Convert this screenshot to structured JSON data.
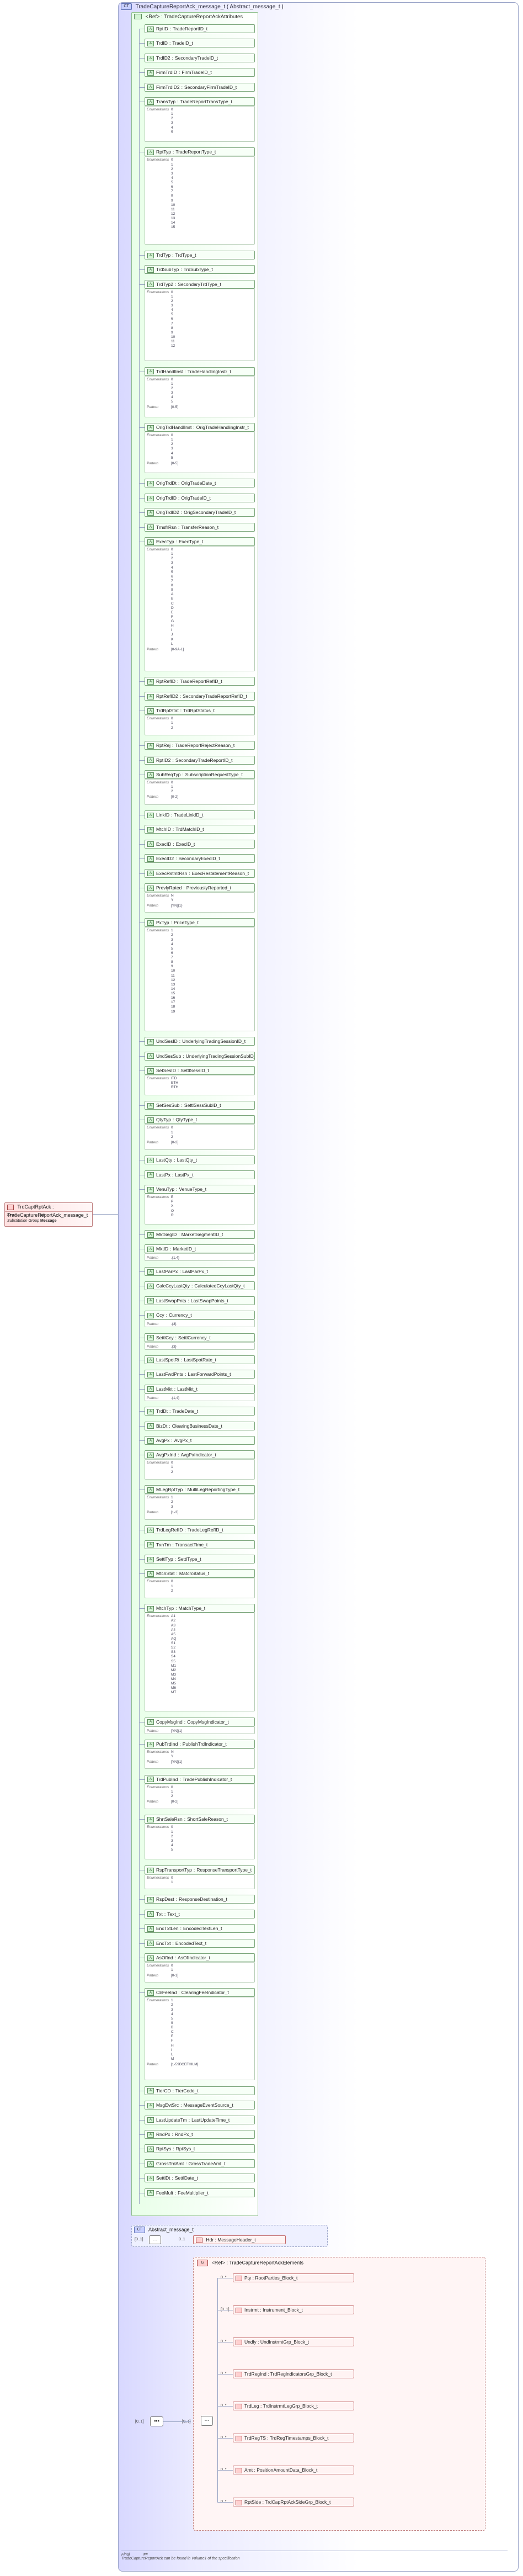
{
  "root": {
    "name": "TrdCaptRptAck",
    "type": "TradeCaptureReportAck_message_t",
    "props": [
      {
        "key": "Final",
        "val": "##"
      },
      {
        "key": "Substitution Group",
        "val": "Message"
      }
    ]
  },
  "complex_type": {
    "title": "TradeCaptureReportAck_message_t ( Abstract_message_t )",
    "icon": "CT",
    "attr_group": {
      "title": "<Ref> : TradeCaptureReportAckAttributes",
      "attributes": [
        {
          "n": "RptID",
          "t": "TradeReportID_t"
        },
        {
          "n": "TrdID",
          "t": "TradeID_t"
        },
        {
          "n": "TrdID2",
          "t": "SecondaryTradeID_t"
        },
        {
          "n": "FirmTrdID",
          "t": "FirmTradeID_t"
        },
        {
          "n": "FirmTrdID2",
          "t": "SecondaryFirmTradeID_t"
        },
        {
          "n": "TransTyp",
          "t": "TradeReportTransType_t",
          "enum": [
            "0",
            "1",
            "2",
            "3",
            "4",
            "5"
          ]
        },
        {
          "n": "RptTyp",
          "t": "TradeReportType_t",
          "enum": [
            "0",
            "1",
            "2",
            "3",
            "4",
            "5",
            "6",
            "7",
            "8",
            "9",
            "10",
            "11",
            "12",
            "13",
            "14",
            "15"
          ]
        },
        {
          "n": "TrdTyp",
          "t": "TrdType_t"
        },
        {
          "n": "TrdSubTyp",
          "t": "TrdSubType_t"
        },
        {
          "n": "TrdTyp2",
          "t": "SecondaryTrdType_t",
          "enum": [
            "0",
            "1",
            "2",
            "3",
            "4",
            "5",
            "6",
            "7",
            "8",
            "9",
            "10",
            "11",
            "12"
          ]
        },
        {
          "n": "TrdHandlInst",
          "t": "TradeHandlingInstr_t",
          "enum": [
            "0",
            "1",
            "2",
            "3",
            "4",
            "5"
          ],
          "pattern": "[0-5]"
        },
        {
          "n": "OrigTrdHandlInst",
          "t": "OrigTradeHandlingInstr_t",
          "enum": [
            "0",
            "1",
            "2",
            "3",
            "4",
            "5"
          ],
          "pattern": "[0-5]"
        },
        {
          "n": "OrigTrdDt",
          "t": "OrigTradeDate_t"
        },
        {
          "n": "OrigTrdID",
          "t": "OrigTradeID_t"
        },
        {
          "n": "OrigTrdID2",
          "t": "OrigSecondaryTradeID_t"
        },
        {
          "n": "TrnsfrRsn",
          "t": "TransferReason_t"
        },
        {
          "n": "ExecTyp",
          "t": "ExecType_t",
          "enum": [
            "0",
            "1",
            "2",
            "3",
            "4",
            "5",
            "6",
            "7",
            "8",
            "9",
            "A",
            "B",
            "C",
            "D",
            "E",
            "F",
            "G",
            "H",
            "I",
            "J",
            "K",
            "L"
          ],
          "pattern": "[0-9A-L]"
        },
        {
          "n": "RptRefID",
          "t": "TradeReportRefID_t"
        },
        {
          "n": "RptRefID2",
          "t": "SecondaryTradeReportRefID_t"
        },
        {
          "n": "TrdRptStat",
          "t": "TrdRptStatus_t",
          "enum": [
            "0",
            "1",
            "2"
          ]
        },
        {
          "n": "RptRej",
          "t": "TradeReportRejectReason_t"
        },
        {
          "n": "RptID2",
          "t": "SecondaryTradeReportID_t"
        },
        {
          "n": "SubReqTyp",
          "t": "SubscriptionRequestType_t",
          "enum": [
            "0",
            "1",
            "2"
          ],
          "pattern": "[0-2]"
        },
        {
          "n": "LinkID",
          "t": "TradeLinkID_t"
        },
        {
          "n": "MtchID",
          "t": "TrdMatchID_t"
        },
        {
          "n": "ExecID",
          "t": "ExecID_t"
        },
        {
          "n": "ExecID2",
          "t": "SecondaryExecID_t"
        },
        {
          "n": "ExecRstmtRsn",
          "t": "ExecRestatementReason_t"
        },
        {
          "n": "PrevlyRpted",
          "t": "PreviouslyReported_t",
          "enum": [
            "N",
            "Y"
          ],
          "pattern": "[YN]{1}"
        },
        {
          "n": "PxTyp",
          "t": "PriceType_t",
          "enum": [
            "1",
            "2",
            "3",
            "4",
            "5",
            "6",
            "7",
            "8",
            "9",
            "10",
            "11",
            "12",
            "13",
            "14",
            "15",
            "16",
            "17",
            "18",
            "19"
          ]
        },
        {
          "n": "UndSesID",
          "t": "UnderlyingTradingSessionID_t"
        },
        {
          "n": "UndSesSub",
          "t": "UnderlyingTradingSessionSubID_t"
        },
        {
          "n": "SetSesID",
          "t": "SettlSessID_t",
          "enum": [
            "ITD",
            "ETH",
            "RTH"
          ]
        },
        {
          "n": "SetSesSub",
          "t": "SettlSessSubID_t"
        },
        {
          "n": "QtyTyp",
          "t": "QtyType_t",
          "enum": [
            "0",
            "1",
            "2"
          ],
          "pattern": "[0-2]"
        },
        {
          "n": "LastQty",
          "t": "LastQty_t"
        },
        {
          "n": "LastPx",
          "t": "LastPx_t"
        },
        {
          "n": "VenuTyp",
          "t": "VenueType_t",
          "enum": [
            "E",
            "P",
            "X",
            "O",
            "R"
          ]
        },
        {
          "n": "MktSegID",
          "t": "MarketSegmentID_t"
        },
        {
          "n": "MktID",
          "t": "MarketID_t",
          "pattern": ".{1,4}"
        },
        {
          "n": "LastParPx",
          "t": "LastParPx_t"
        },
        {
          "n": "CalcCcyLastQty",
          "t": "CalculatedCcyLastQty_t"
        },
        {
          "n": "LastSwapPnts",
          "t": "LastSwapPoints_t"
        },
        {
          "n": "Ccy",
          "t": "Currency_t",
          "pattern": ".{3}"
        },
        {
          "n": "SettlCcy",
          "t": "SettlCurrency_t",
          "pattern": ".{3}"
        },
        {
          "n": "LastSpotRt",
          "t": "LastSpotRate_t"
        },
        {
          "n": "LastFwdPnts",
          "t": "LastForwardPoints_t"
        },
        {
          "n": "LastMkt",
          "t": "LastMkt_t",
          "pattern": ".{1,4}"
        },
        {
          "n": "TrdDt",
          "t": "TradeDate_t"
        },
        {
          "n": "BizDt",
          "t": "ClearingBusinessDate_t"
        },
        {
          "n": "AvgPx",
          "t": "AvgPx_t"
        },
        {
          "n": "AvgPxInd",
          "t": "AvgPxIndicator_t",
          "enum": [
            "0",
            "1",
            "2"
          ]
        },
        {
          "n": "MLegRptTyp",
          "t": "MultiLegReportingType_t",
          "enum": [
            "1",
            "2",
            "3"
          ],
          "pattern": "[1-3]"
        },
        {
          "n": "TrdLegRefID",
          "t": "TradeLegRefID_t"
        },
        {
          "n": "TxnTm",
          "t": "TransactTime_t"
        },
        {
          "n": "SettlTyp",
          "t": "SettlType_t"
        },
        {
          "n": "MtchStat",
          "t": "MatchStatus_t",
          "enum": [
            "0",
            "1",
            "2"
          ]
        },
        {
          "n": "MtchTyp",
          "t": "MatchType_t",
          "enum": [
            "A1",
            "A2",
            "A3",
            "A4",
            "A5",
            "AQ",
            "S1",
            "S2",
            "S3",
            "S4",
            "S5",
            "M1",
            "M2",
            "M3",
            "M4",
            "M5",
            "M6",
            "MT"
          ]
        },
        {
          "n": "CopyMsgInd",
          "t": "CopyMsgIndicator_t",
          "pattern": "[YN]{1}"
        },
        {
          "n": "PubTrdInd",
          "t": "PublishTrdIndicator_t",
          "enum": [
            "N",
            "Y"
          ],
          "pattern": "[YN]{1}"
        },
        {
          "n": "TrdPubInd",
          "t": "TradePublishIndicator_t",
          "enum": [
            "0",
            "1",
            "2"
          ],
          "pattern": "[0-2]"
        },
        {
          "n": "ShrtSaleRsn",
          "t": "ShortSaleReason_t",
          "enum": [
            "0",
            "1",
            "2",
            "3",
            "4",
            "5"
          ]
        },
        {
          "n": "RspTransportTyp",
          "t": "ResponseTransportType_t",
          "enum": [
            "0",
            "1"
          ]
        },
        {
          "n": "RspDest",
          "t": "ResponseDestination_t"
        },
        {
          "n": "Txt",
          "t": "Text_t"
        },
        {
          "n": "EncTxtLen",
          "t": "EncodedTextLen_t"
        },
        {
          "n": "EncTxt",
          "t": "EncodedText_t"
        },
        {
          "n": "AsOfInd",
          "t": "AsOfIndicator_t",
          "enum": [
            "0",
            "1"
          ],
          "pattern": "[0-1]"
        },
        {
          "n": "ClrFeeInd",
          "t": "ClearingFeeIndicator_t",
          "enum": [
            "1",
            "2",
            "3",
            "4",
            "5",
            "9",
            "B",
            "C",
            "E",
            "F",
            "H",
            "I",
            "L",
            "M"
          ],
          "pattern": "[1-59BCEFHILM]"
        },
        {
          "n": "TierCD",
          "t": "TierCode_t"
        },
        {
          "n": "MsgEvtSrc",
          "t": "MessageEventSource_t"
        },
        {
          "n": "LastUpdateTm",
          "t": "LastUpdateTime_t"
        },
        {
          "n": "RndPx",
          "t": "RndPx_t"
        },
        {
          "n": "RptSys",
          "t": "RptSys_t"
        },
        {
          "n": "GrossTrdAmt",
          "t": "GrossTradeAmt_t"
        },
        {
          "n": "SettlDt",
          "t": "SettlDate_t"
        },
        {
          "n": "FeeMult",
          "t": "FeeMultiplier_t"
        }
      ]
    },
    "abstract_message": {
      "title": "Abstract_message_t",
      "mult": "[0..1]",
      "hdr": {
        "name": "Hdr",
        "type": "MessageHeader_t",
        "mult": "0..1"
      }
    },
    "elements_group": {
      "title": "<Ref> : TradeCaptureReportAckElements",
      "seq_mult": "[0..1]",
      "inner_mult": "[0..1]",
      "elements": [
        {
          "n": "Pty",
          "t": "RootParties_Block_t",
          "m": "0..*"
        },
        {
          "n": "Instrmt",
          "t": "Instrument_Block_t",
          "m": "[0..1]"
        },
        {
          "n": "Undly",
          "t": "UndInstrmtGrp_Block_t",
          "m": "0..*"
        },
        {
          "n": "TrdRegInd",
          "t": "TrdRegIndicatorsGrp_Block_t",
          "m": "0..*"
        },
        {
          "n": "TrdLeg",
          "t": "TrdInstrmtLegGrp_Block_t",
          "m": "0..*"
        },
        {
          "n": "TrdRegTS",
          "t": "TrdRegTimestamps_Block_t",
          "m": "0..*"
        },
        {
          "n": "Amt",
          "t": "PositionAmountData_Block_t",
          "m": "0..*"
        },
        {
          "n": "RptSide",
          "t": "TrdCapRptAckSideGrp_Block_t",
          "m": "0..*"
        }
      ]
    },
    "footer": {
      "key": "Final",
      "val": "##",
      "note": "TradeCaptureReportAck can be found in Volume1 of the specification"
    }
  }
}
